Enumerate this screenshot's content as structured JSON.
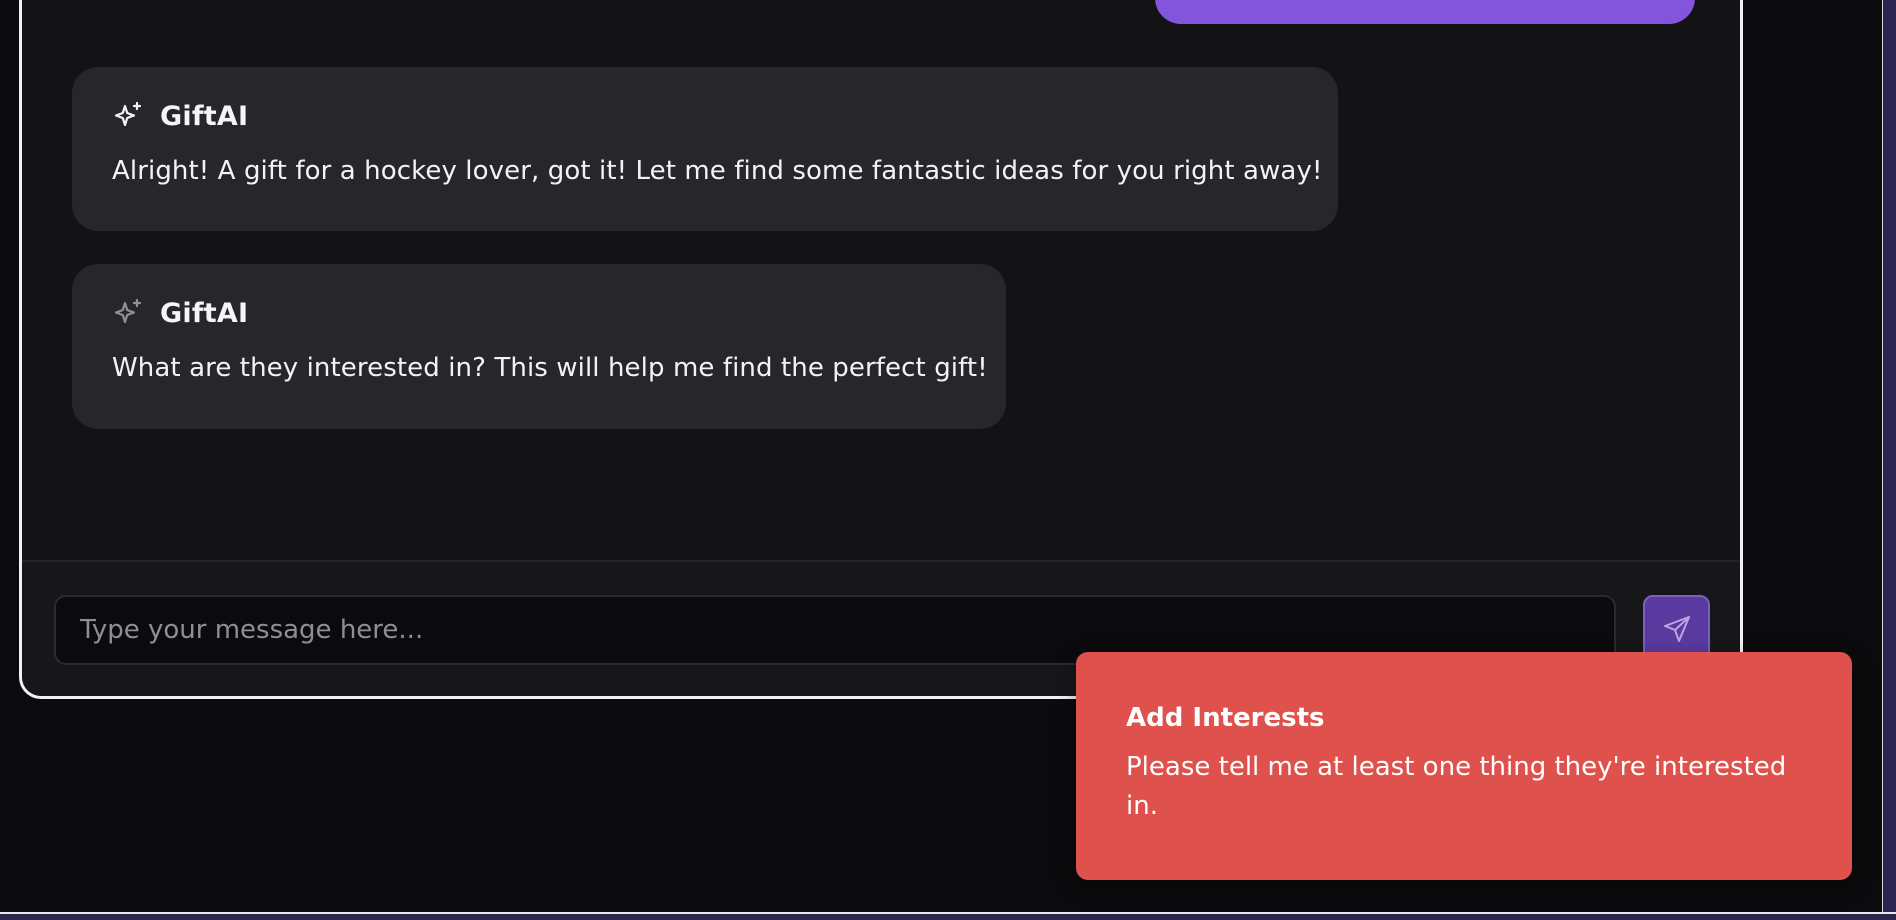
{
  "colors": {
    "page_background": "#0b0b0d",
    "card_background": "#131316",
    "bot_bubble": "#27272b",
    "user_bubble": "#8355dc",
    "send_button": "#5a3a9e",
    "toast_background": "#de514c"
  },
  "chat": {
    "messages": [
      {
        "role": "assistant",
        "sender": "GiftAI",
        "icon": "sparkles-icon",
        "text": "Alright! A gift for a hockey lover, got it! Let me find some fantastic ideas for you right away!"
      },
      {
        "role": "assistant",
        "sender": "GiftAI",
        "icon": "sparkles-icon",
        "text": "What are they interested in? This will help me find the perfect gift!"
      }
    ]
  },
  "composer": {
    "placeholder": "Type your message here...",
    "value": "",
    "send_icon": "send-icon"
  },
  "toast": {
    "title": "Add Interests",
    "description": "Please tell me at least one thing they're interested in."
  }
}
